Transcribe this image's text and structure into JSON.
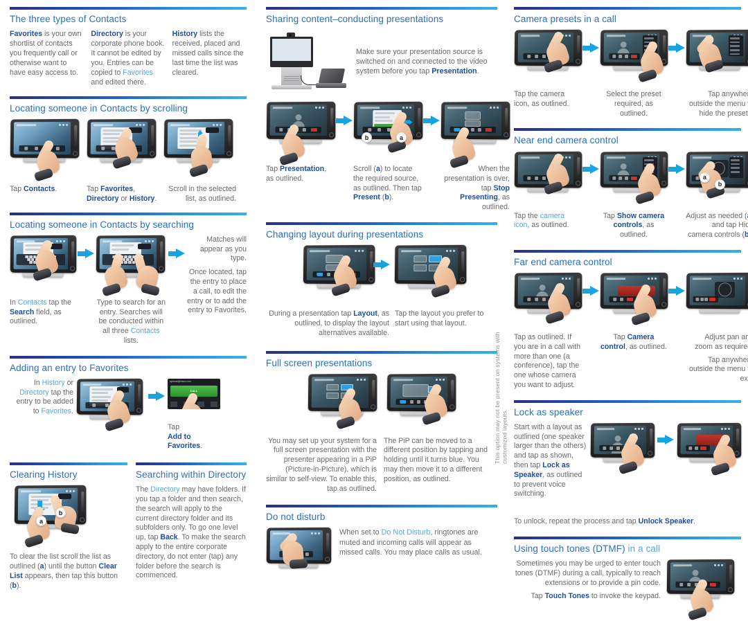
{
  "colors": {
    "accent": "#18a4e0",
    "heading": "#2a6fc0",
    "bold_blue": "#1f4e9c",
    "light_blue": "#59a7dd",
    "body": "#6a6a6e"
  },
  "left_column": {
    "contacts_types": {
      "title": "The three types of Contacts",
      "columns": [
        {
          "term": "Favorites",
          "text": " is your own shortlist of contacts you frequently call or otherwise want to have easy access to."
        },
        {
          "term": "Directory",
          "text_a": " is your corporate phone book. It cannot be edited by you. Entries can be copied to ",
          "link": "Favorites",
          "text_b": " and edited there."
        },
        {
          "term": "History",
          "text": " lists the received, placed and missed calls since the last time the list was cleared."
        }
      ]
    },
    "scrolling": {
      "title": "Locating someone in Contacts by scrolling",
      "steps": [
        {
          "pre": "Tap ",
          "bold": "Contacts",
          "post": "."
        },
        {
          "pre": "Tap ",
          "bold": "Favorites",
          "mid": ", ",
          "bold2": "Directory",
          "mid2": " or ",
          "bold3": "History",
          "post": "."
        },
        {
          "text": "Scroll in the selected list, as outlined."
        }
      ]
    },
    "searching": {
      "title": "Locating someone in Contacts by searching",
      "step1": {
        "pre": "In ",
        "link": "Contacts",
        "mid": " tap the ",
        "bold": "Search",
        "post": " field, as outlined."
      },
      "step2": {
        "pre": "Type to search for an entry. Searches will be conducted within all three ",
        "link": "Contacts",
        "post": " lists."
      },
      "step3_a": "Matches will appear as you type.",
      "step3_b": "Once located, tap the entry to place a call, to edit the entry or to add the entry to Favorites."
    },
    "favorites": {
      "title": "Adding an entry to Favorites",
      "intro": {
        "pre": "In ",
        "link1": "History",
        "mid1": " or ",
        "link2": "Directory",
        "mid2": " tap the entry to be added to ",
        "link3": "Favorites",
        "post": "."
      },
      "caption": {
        "pre": "Tap ",
        "bold": "Add to Favorites",
        "post": "."
      },
      "screen_label": "aphone@cisco.com",
      "screen_button": "CALL"
    },
    "clearing_history": {
      "title": "Clearing History",
      "marker_a": "a",
      "marker_b": "b",
      "caption_pre": "To clear the list scroll the list as outlined (",
      "caption_a": "a",
      "caption_mid": ") until the button ",
      "caption_bold": "Clear List",
      "caption_mid2": " appears, then tap this button (",
      "caption_b": "b",
      "caption_post": ")."
    },
    "searching_directory": {
      "title": "Searching within Directory",
      "pre": "The ",
      "link": "Directory",
      "mid": " may have folders. If you tap a folder and then search, the search will apply to the current directory folder and its subfolders only. To go one level up, tap ",
      "bold": "Back",
      "post": ". To make the search apply to the entire corporate directory, do not enter (tap) any folder before the search is commenced."
    }
  },
  "mid_column": {
    "sharing": {
      "title": "Sharing content–conducting presentations",
      "pre": "Make sure your presentation source is switched on and connected to the video system before you tap ",
      "bold": "Presentation",
      "post": "."
    },
    "present_steps": [
      {
        "pre": "Tap ",
        "bold": "Presentation",
        "post": ", as outlined."
      },
      {
        "pre": "Scroll (",
        "a": "a",
        "mid": ") to locate the required source, as outlined. Then tap ",
        "bold": "Present",
        "mid2": " (",
        "b": "b",
        "post": ")."
      },
      {
        "pre": "When the presentation is over, tap ",
        "bold": "Stop Presenting",
        "post": ", as outlined."
      }
    ],
    "changing_layout": {
      "title": "Changing layout during presentations",
      "cap1_pre": "During a presentation tap ",
      "cap1_bold": "Layout",
      "cap1_post": ", as outlined, to display the layout alternatives available.",
      "cap2": "Tap the layout you prefer to start using that layout."
    },
    "full_screen": {
      "title": "Full screen presentations",
      "cap1": "You may set up your system for a full screen presentation with the presenter appearing in a PiP (Picture-in-Picture), which is similar to self-view. To enable this, tap as outlined.",
      "cap2": "The PiP can be moved to a different position by tapping and holding until it turns blue. You may then move it to a different position, as outlined."
    },
    "side_note": "This option may not be present on systems with customized layouts.",
    "do_not_disturb": {
      "title": "Do not disturb",
      "pre": "When set to ",
      "link": "Do Not Disturb",
      "post": ", ringtones are muted and incoming calls will appear as missed calls. You may place calls as usual."
    }
  },
  "right_column": {
    "camera_presets": {
      "title": "Camera presets in a call",
      "steps": [
        "Tap the camera icon, as outlined.",
        "Select the preset required, as outlined.",
        "Tap anywhere outside the menu to hide the presets."
      ]
    },
    "near_end": {
      "title": "Near end camera control",
      "cap1_pre": "Tap the ",
      "cap1_link": "camera icon",
      "cap1_post": ", as outlined.",
      "cap2_pre": "Tap ",
      "cap2_bold": "Show camera controls",
      "cap2_post": ", as outlined.",
      "cap3_pre": "Adjust as needed (",
      "cap3_a": "a",
      "cap3_mid": ") and tap Hide camera controls (",
      "cap3_b": "b",
      "cap3_post": ")."
    },
    "far_end": {
      "title": "Far end camera control",
      "cap1": "Tap as outlined. If you are in a call with more than one (a conference), tap the one whose camera you want to adjust.",
      "cap2_pre": "Tap ",
      "cap2_bold": "Camera control",
      "cap2_post": ", as outlined.",
      "cap3_a": "Adjust pan and zoom as required.",
      "cap3_b": "Tap anywhere outside the menu to exit."
    },
    "lock_speaker": {
      "title": "Lock as speaker",
      "pre": "Start with a layout as outlined (one speaker larger than the others) and tap as shown, then tap ",
      "bold": "Lock as Speaker",
      "post": ", as outlined to prevent voice switching.",
      "footer_pre": "To unlock, repeat the process and tap ",
      "footer_bold": "Unlock Speaker",
      "footer_post": "."
    },
    "dtmf": {
      "title_a": "Using touch tones (DTMF) ",
      "title_b": "in a call",
      "body": "Sometimes you may be urged to enter touch tones (DTMF) during a call, typically to reach extensions or to provide a pin code.",
      "footer_pre": "Tap ",
      "footer_bold": "Touch Tones",
      "footer_post": " to invoke the keypad."
    }
  }
}
